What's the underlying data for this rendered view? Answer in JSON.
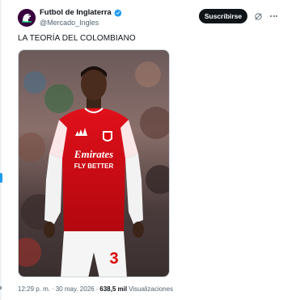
{
  "account": {
    "display_name": "Futbol de Inglaterra",
    "handle": "@Mercado_Ingles",
    "avatar_icon": "premier-league-lion-logo",
    "verified_icon": "verified-badge-icon",
    "verified_color": "#1d9bf0"
  },
  "actions": {
    "subscribe_label": "Suscribirse",
    "grok_icon": "grok-icon",
    "more_icon": "more-options-icon"
  },
  "tweet": {
    "text": "LA TEORÍA DEL COLOMBIANO"
  },
  "media": {
    "jersey_sponsor_line1": "Emirates",
    "jersey_sponsor_line2": "FLY BETTER",
    "shirt_number": "3"
  },
  "meta": {
    "time": "12:29 p. m.",
    "separator1": "·",
    "date": "30 may. 2026",
    "separator2": "·",
    "views_count": "638,5 mil",
    "views_label": "Visualizaciones"
  },
  "colors": {
    "accent": "#1d9bf0",
    "button_bg": "#0f1419",
    "secondary_text": "#536471",
    "arsenal_red": "#db0007"
  }
}
